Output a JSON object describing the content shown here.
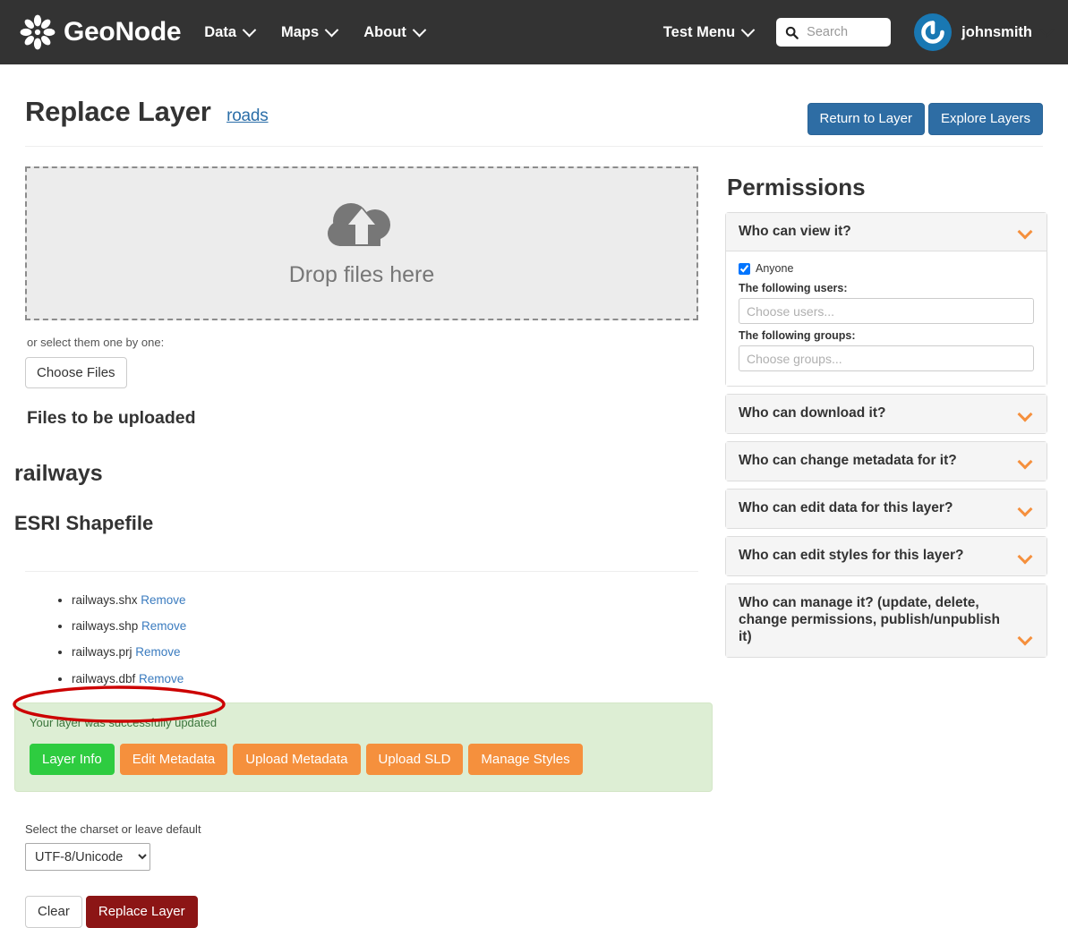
{
  "navbar": {
    "brand": "GeoNode",
    "links": [
      {
        "label": "Data"
      },
      {
        "label": "Maps"
      },
      {
        "label": "About"
      }
    ],
    "test_menu": "Test Menu",
    "search_placeholder": "Search",
    "search_value": "",
    "username": "johnsmith"
  },
  "page": {
    "title": "Replace Layer",
    "layer_link": "roads",
    "actions": {
      "return_to_layer": "Return to Layer",
      "explore_layers": "Explore Layers"
    }
  },
  "upload": {
    "dropzone_text": "Drop files here",
    "hint": "or select them one by one:",
    "choose_files": "Choose Files",
    "files_heading": "Files to be uploaded",
    "file_group_name": "railways",
    "file_type": "ESRI Shapefile",
    "files": [
      {
        "name": "railways.shx",
        "remove": "Remove"
      },
      {
        "name": "railways.shp",
        "remove": "Remove"
      },
      {
        "name": "railways.prj",
        "remove": "Remove"
      },
      {
        "name": "railways.dbf",
        "remove": "Remove"
      }
    ]
  },
  "alert": {
    "message": "Your layer was successfully updated",
    "buttons": [
      {
        "label": "Layer Info",
        "style": "green"
      },
      {
        "label": "Edit Metadata",
        "style": "orange"
      },
      {
        "label": "Upload Metadata",
        "style": "orange"
      },
      {
        "label": "Upload SLD",
        "style": "orange"
      },
      {
        "label": "Manage Styles",
        "style": "orange"
      }
    ]
  },
  "charset": {
    "label": "Select the charset or leave default",
    "selected": "UTF-8/Unicode",
    "options": [
      "UTF-8/Unicode"
    ]
  },
  "footer_buttons": {
    "clear": "Clear",
    "replace_layer": "Replace Layer"
  },
  "permissions": {
    "title": "Permissions",
    "view_panel": {
      "title": "Who can view it?",
      "anyone_label": "Anyone",
      "anyone_checked": true,
      "users_label": "The following users:",
      "users_placeholder": "Choose users...",
      "users_value": "",
      "groups_label": "The following groups:",
      "groups_placeholder": "Choose groups...",
      "groups_value": ""
    },
    "panels": [
      {
        "title": "Who can download it?"
      },
      {
        "title": "Who can change metadata for it?"
      },
      {
        "title": "Who can edit data for this layer?"
      },
      {
        "title": "Who can edit styles for this layer?"
      },
      {
        "title": "Who can manage it? (update, delete, change permissions, publish/unpublish it)"
      }
    ]
  },
  "colors": {
    "navbar_bg": "#333333",
    "primary_blue": "#2e6da4",
    "accent_orange": "#f5903d",
    "success_green": "#2ecc40",
    "alert_bg": "#ddeed4",
    "danger_red": "#8c1515",
    "annotation_red": "#cc0000",
    "avatar_blue": "#1978b3"
  }
}
